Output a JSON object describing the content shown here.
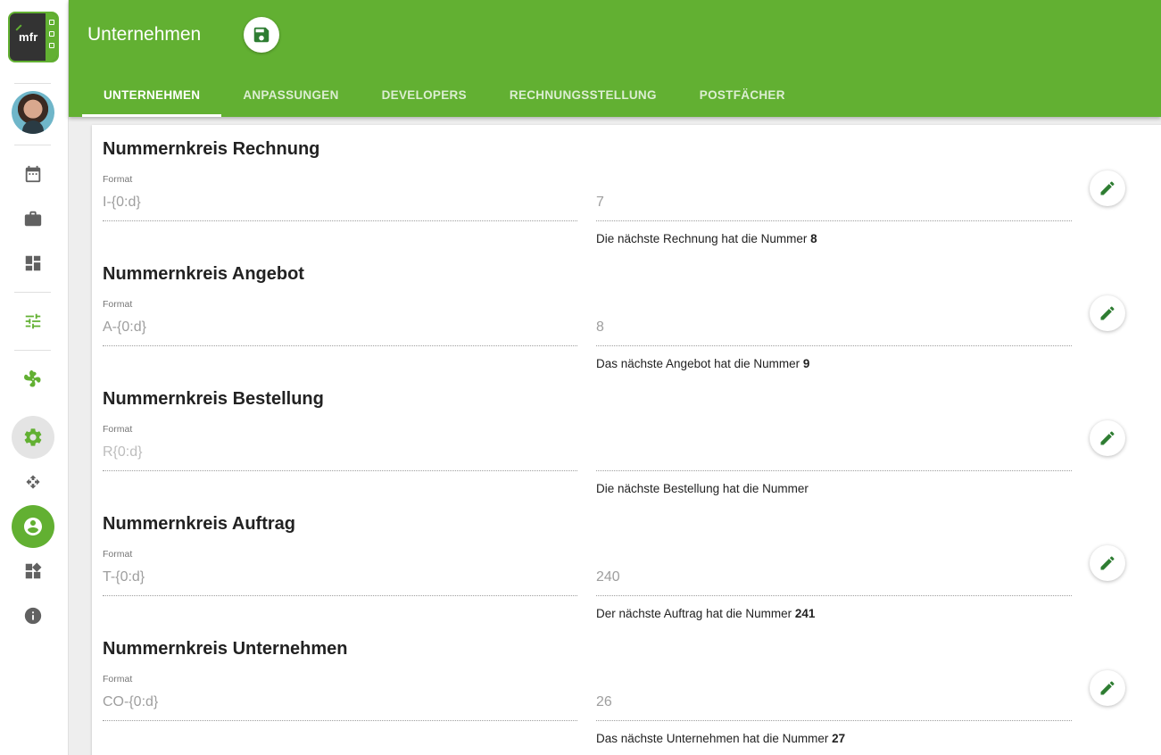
{
  "app": {
    "logo_text": "mfr"
  },
  "header": {
    "title": "Unternehmen",
    "save_icon": "save-icon"
  },
  "tabs": [
    {
      "label": "UNTERNEHMEN",
      "active": true
    },
    {
      "label": "ANPASSUNGEN",
      "active": false
    },
    {
      "label": "DEVELOPERS",
      "active": false
    },
    {
      "label": "RECHNUNGSSTELLUNG",
      "active": false
    },
    {
      "label": "POSTFÄCHER",
      "active": false
    }
  ],
  "sidebar": {
    "icons": [
      "calendar-icon",
      "briefcase-icon",
      "dashboard-icon",
      "tune-icon",
      "pinwheel-icon",
      "settings-icon",
      "move-icon",
      "account-circle-icon",
      "widgets-icon",
      "info-icon"
    ]
  },
  "colors": {
    "brand": "#62b032",
    "edit_icon": "#2e7d32"
  },
  "sections": [
    {
      "title": "Nummernkreis Rechnung",
      "format_label": "Format",
      "format_value": "I-{0:d}",
      "number_value": "7",
      "hint_text": "Die nächste Rechnung hat die Nummer ",
      "hint_number": "8"
    },
    {
      "title": "Nummernkreis Angebot",
      "format_label": "Format",
      "format_value": "A-{0:d}",
      "number_value": "8",
      "hint_text": "Das nächste Angebot hat die Nummer ",
      "hint_number": "9"
    },
    {
      "title": "Nummernkreis Bestellung",
      "format_label": "Format",
      "format_value": "R{0:d}",
      "number_value": "",
      "hint_text": "Die nächste Bestellung hat die Nummer",
      "hint_number": ""
    },
    {
      "title": "Nummernkreis Auftrag",
      "format_label": "Format",
      "format_value": "T-{0:d}",
      "number_value": "240",
      "hint_text": "Der nächste Auftrag hat die Nummer ",
      "hint_number": "241"
    },
    {
      "title": "Nummernkreis Unternehmen",
      "format_label": "Format",
      "format_value": "CO-{0:d}",
      "number_value": "26",
      "hint_text": "Das nächste Unternehmen hat die Nummer ",
      "hint_number": "27"
    }
  ]
}
